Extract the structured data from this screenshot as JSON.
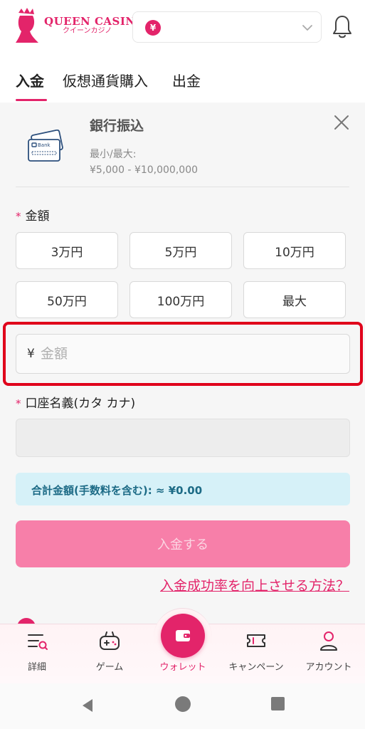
{
  "header": {
    "logo_en": "QUEEN CASINO",
    "logo_jp": "クイーンカジノ",
    "currency_symbol": "¥",
    "brand_color": "#e3246a"
  },
  "tabs": [
    {
      "label": "入金",
      "active": true
    },
    {
      "label": "仮想通貨購入",
      "active": false
    },
    {
      "label": "出金",
      "active": false
    }
  ],
  "method": {
    "title": "銀行振込",
    "icon_text": "Bank",
    "limits_label": "最小/最大:",
    "limits_range": "¥5,000 - ¥10,000,000"
  },
  "amount": {
    "label": "金額",
    "required_mark": "*",
    "presets": [
      "3万円",
      "5万円",
      "10万円",
      "50万円",
      "100万円",
      "最大"
    ],
    "currency_prefix": "¥",
    "placeholder": "金額"
  },
  "account_name": {
    "label": "口座名義(カタ カナ)",
    "required_mark": "*",
    "value": ""
  },
  "total": {
    "text": "合計金額(手数料を含む): ≈ ¥0.00"
  },
  "submit": {
    "label": "入金する"
  },
  "help_link": "入金成功率を向上させる方法？",
  "bottom_nav": [
    {
      "label": "詳細",
      "icon": "menu-search-icon"
    },
    {
      "label": "ゲーム",
      "icon": "gamepad-icon"
    },
    {
      "label": "ウォレット",
      "icon": "wallet-icon",
      "active": true
    },
    {
      "label": "キャンペーン",
      "icon": "ticket-icon"
    },
    {
      "label": "アカウント",
      "icon": "user-icon"
    }
  ]
}
